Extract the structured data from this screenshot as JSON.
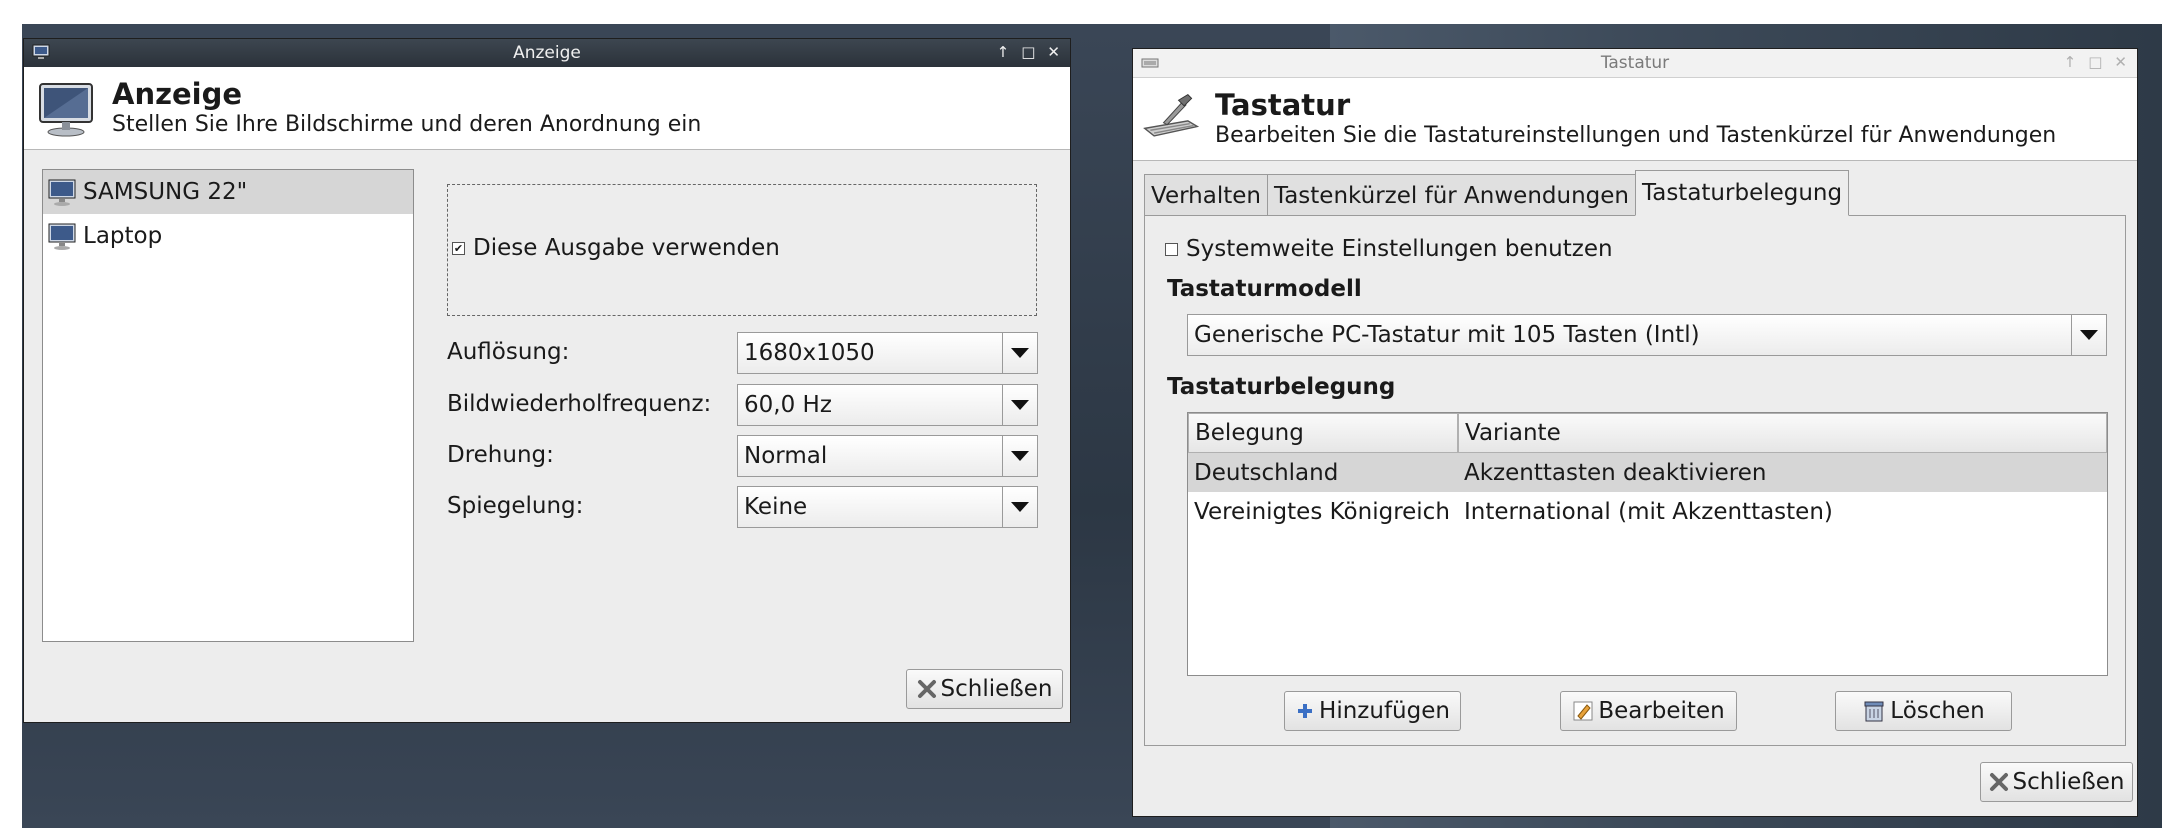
{
  "anzeige": {
    "window_title": "Anzeige",
    "title_controls": [
      "↑",
      "□",
      "✕"
    ],
    "header_title": "Anzeige",
    "header_subtitle": "Stellen Sie Ihre Bildschirme und deren Anordnung ein",
    "outputs": [
      "SAMSUNG 22\"",
      "Laptop"
    ],
    "use_output_label": "Diese Ausgabe verwenden",
    "use_output_checked": "✔",
    "fields": {
      "resolution_label": "Auflösung:",
      "resolution_value": "1680x1050",
      "refresh_label": "Bildwiederholfrequenz:",
      "refresh_value": "60,0 Hz",
      "rotation_label": "Drehung:",
      "rotation_value": "Normal",
      "mirror_label": "Spiegelung:",
      "mirror_value": "Keine"
    },
    "close_label": "Schließen"
  },
  "tastatur": {
    "window_title": "Tastatur",
    "title_controls": [
      "↑",
      "□",
      "✕"
    ],
    "header_title": "Tastatur",
    "header_subtitle": "Bearbeiten Sie die Tastatureinstellungen und Tastenkürzel für Anwendungen",
    "tabs": [
      "Verhalten",
      "Tastenkürzel für Anwendungen",
      "Tastaturbelegung"
    ],
    "active_tab": "Tastaturbelegung",
    "system_settings_label": "Systemweite Einstellungen benutzen",
    "model_heading": "Tastaturmodell",
    "model_value": "Generische PC-Tastatur mit 105 Tasten (Intl)",
    "layout_heading": "Tastaturbelegung",
    "table": {
      "columns": [
        "Belegung",
        "Variante"
      ],
      "rows": [
        [
          "Deutschland",
          "Akzenttasten deaktivieren"
        ],
        [
          "Vereinigtes Königreich",
          "International (mit Akzenttasten)"
        ]
      ]
    },
    "add_label": "Hinzufügen",
    "edit_label": "Bearbeiten",
    "delete_label": "Löschen",
    "close_label": "Schließen"
  }
}
